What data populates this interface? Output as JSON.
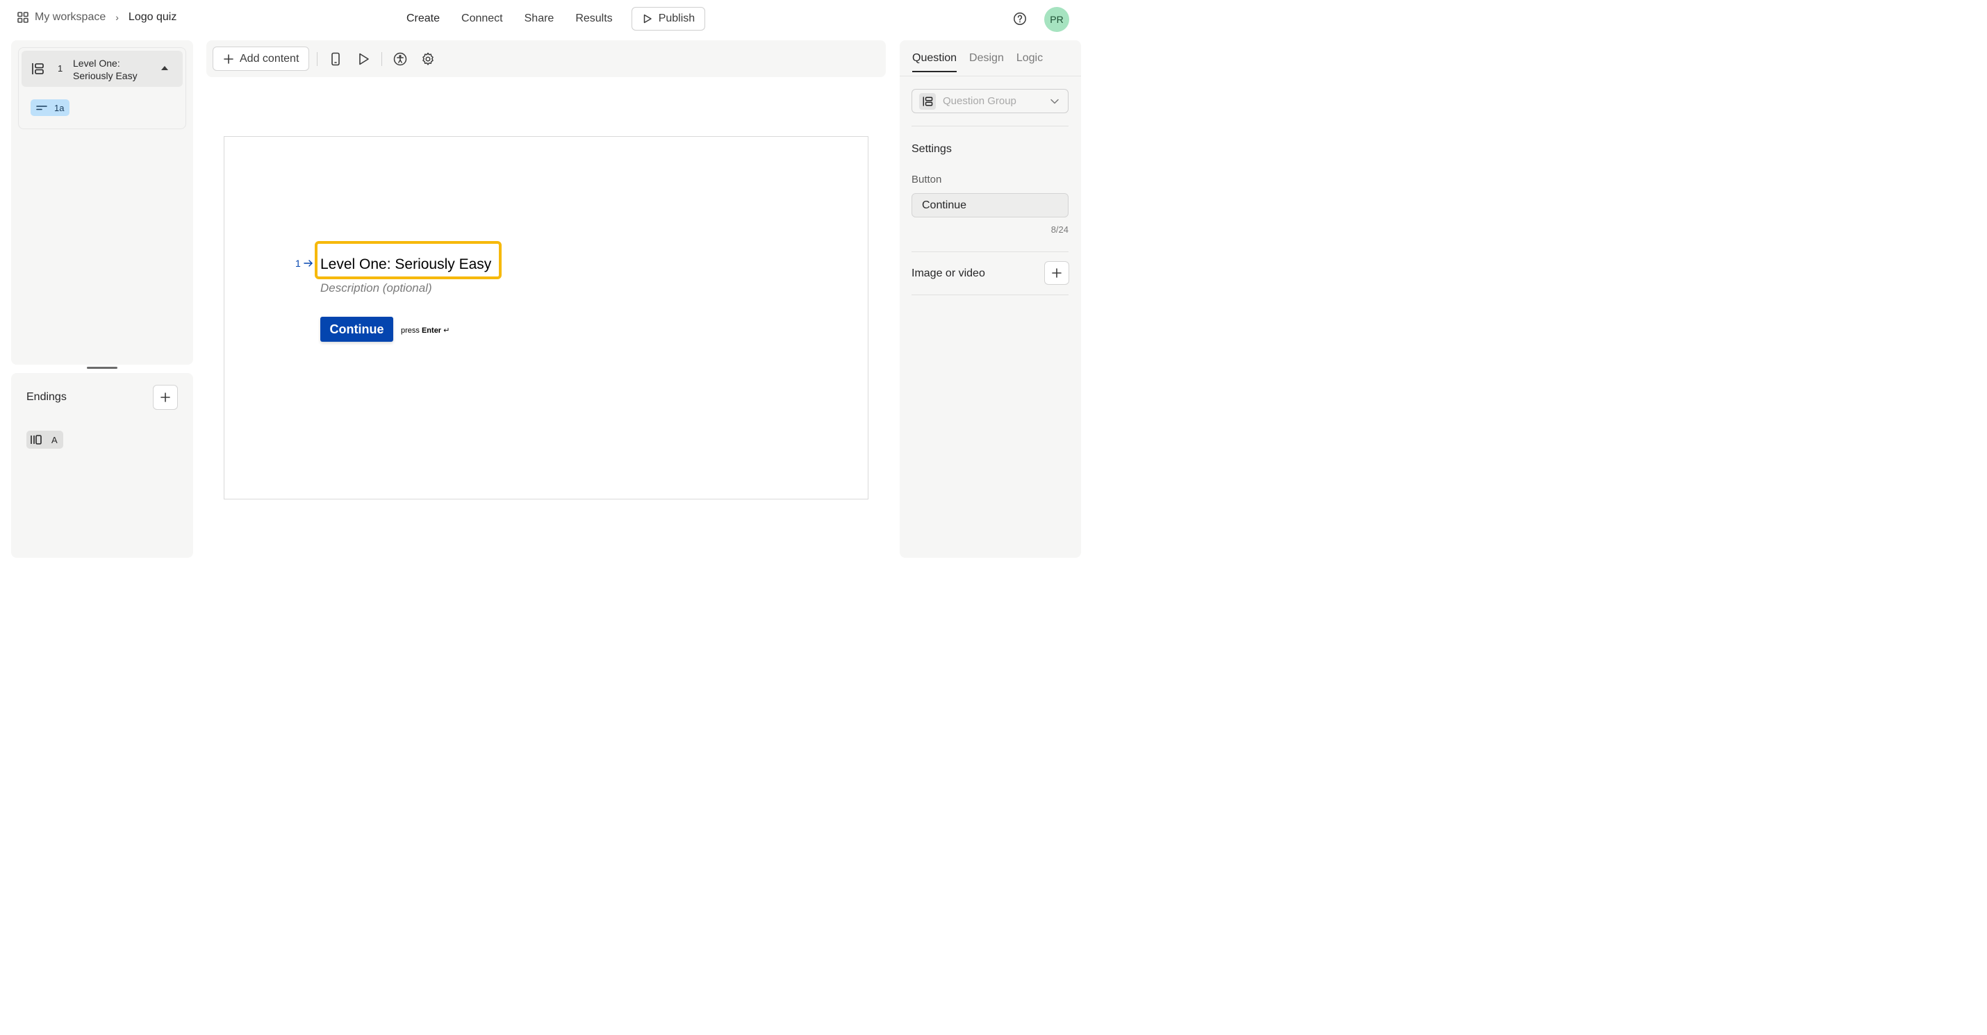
{
  "header": {
    "workspace_label": "My workspace",
    "breadcrumb_separator": "›",
    "form_name": "Logo quiz",
    "nav": [
      "Create",
      "Connect",
      "Share",
      "Results"
    ],
    "publish_label": "Publish",
    "avatar_initials": "PR"
  },
  "sidebar": {
    "group": {
      "number": "1",
      "title": "Level One: Seriously Easy",
      "sub_item_label": "1a"
    },
    "endings": {
      "title": "Endings",
      "item_label": "A"
    }
  },
  "toolbar": {
    "add_content_label": "Add content"
  },
  "canvas": {
    "question_number": "1",
    "question_title": "Level One: Seriously Easy",
    "description_placeholder": "Description (optional)",
    "continue_label": "Continue",
    "press_label": "press",
    "enter_label": "Enter",
    "enter_glyph": "↵"
  },
  "right_panel": {
    "tabs": [
      "Question",
      "Design",
      "Logic"
    ],
    "question_type": "Question Group",
    "settings_title": "Settings",
    "button_label": "Button",
    "button_value": "Continue",
    "char_counter": "8/24",
    "media_label": "Image or video"
  },
  "colors": {
    "accent_blue": "#0445af",
    "highlight_yellow": "#f6b90c",
    "avatar_green": "#a6e3c0",
    "sub_item_blue": "#bde0fa"
  }
}
